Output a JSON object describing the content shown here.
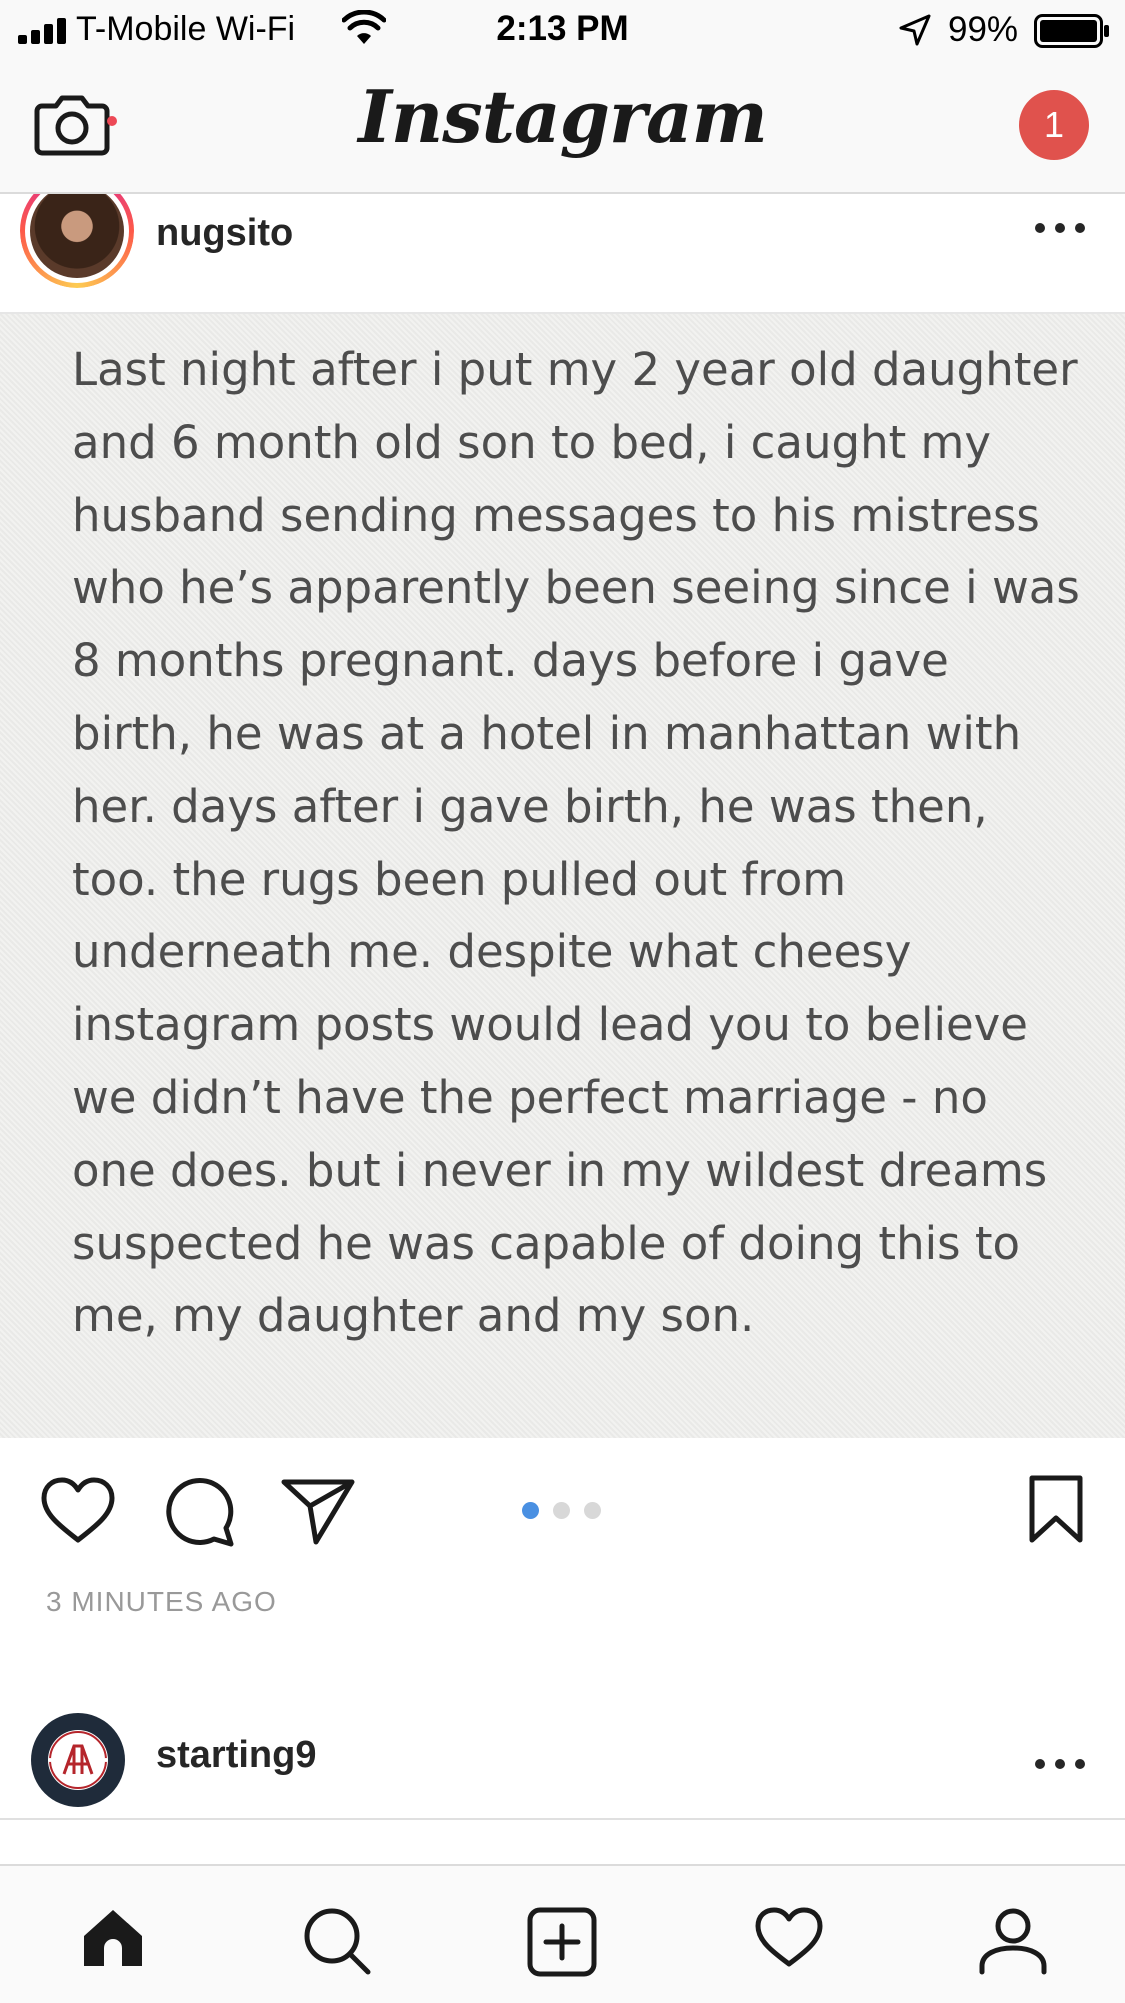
{
  "status_bar": {
    "carrier": "T-Mobile Wi-Fi",
    "time": "2:13 PM",
    "battery": "99%",
    "battery_level": 0.99,
    "icons": [
      "signal-icon",
      "wifi-icon",
      "location-icon",
      "battery-icon"
    ]
  },
  "nav": {
    "logo": "Instagram",
    "direct_badge_count": "1",
    "camera_icon": "camera-icon",
    "badge_color": "#e0524d"
  },
  "post": {
    "username": "nugsito",
    "image_text": "Last night after i put my 2 year old daughter and 6 month old son to bed, i caught my husband sending messages to his mistress who he’s apparently been seeing since i was 8 months pregnant. days before i gave birth, he was at a hotel in manhattan with her. days after i gave birth, he was then, too. the rugs been pulled out from underneath me. despite what cheesy instagram posts would lead you to believe we didn’t have the perfect marriage - no one does. but i never in my wildest dreams suspected he was capable of doing this to me, my daughter and my son.",
    "carousel": {
      "count": 3,
      "active_index": 0
    },
    "timestamp": "3 MINUTES AGO",
    "action_icons": [
      "heart-icon",
      "comment-icon",
      "share-icon",
      "bookmark-icon"
    ],
    "accent_color": "#4a90e2"
  },
  "next_post": {
    "username": "starting9"
  },
  "tab_bar": {
    "tabs": [
      "home-icon",
      "search-icon",
      "add-icon",
      "activity-icon",
      "profile-icon"
    ],
    "active": "home-icon",
    "notification_dot_color": "#ed4956"
  }
}
